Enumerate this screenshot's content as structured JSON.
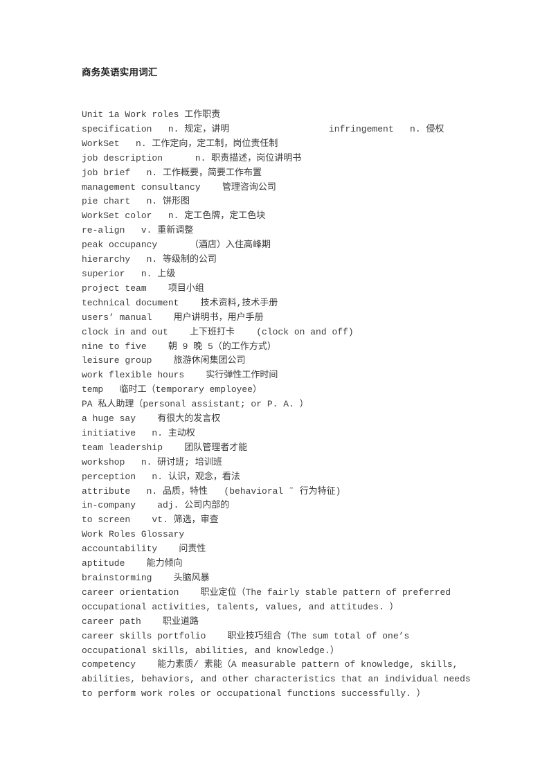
{
  "document": {
    "title": "商务英语实用词汇",
    "background_color": "#ffffff",
    "text_color": "#3a3a3a",
    "title_color": "#1d1d1d"
  },
  "body": {
    "lines": [
      {
        "id": "unit-heading",
        "text": "Unit 1a Work roles 工作职责"
      },
      {
        "id": "specification",
        "text": "specification   n. 规定，讲明",
        "right": "infringement   n. 侵权"
      },
      {
        "id": "workset",
        "text": "WorkSet   n. 工作定向，定工制，岗位责任制"
      },
      {
        "id": "job-description",
        "text": "job description      n. 职责描述，岗位讲明书"
      },
      {
        "id": "job-brief",
        "text": "job brief   n. 工作概要，简要工作布置"
      },
      {
        "id": "management-consultancy",
        "text": "management consultancy    管理咨询公司"
      },
      {
        "id": "pie-chart",
        "text": "pie chart   n. 饼形图"
      },
      {
        "id": "workset-color",
        "text": "WorkSet color   n. 定工色牌，定工色块"
      },
      {
        "id": "re-align",
        "text": "re-align   v. 重新调整"
      },
      {
        "id": "peak-occupancy",
        "text": "peak occupancy      （酒店）入住高峰期"
      },
      {
        "id": "hierarchy",
        "text": "hierarchy   n. 等级制的公司"
      },
      {
        "id": "superior",
        "text": "superior   n. 上级"
      },
      {
        "id": "project-team",
        "text": "project team    项目小组"
      },
      {
        "id": "technical-document",
        "text": "technical document    技术资料,技术手册"
      },
      {
        "id": "users-manual",
        "text": "users’ manual    用户讲明书，用户手册"
      },
      {
        "id": "clock-in-and-out",
        "text": "clock in and out    上下班打卡    (clock on and off)"
      },
      {
        "id": "nine-to-five",
        "text": "nine to five    朝 9 晚 5（的工作方式）"
      },
      {
        "id": "leisure-group",
        "text": "leisure group    旅游休闲集团公司"
      },
      {
        "id": "work-flexible-hours",
        "text": "work flexible hours    实行弹性工作时间"
      },
      {
        "id": "temp",
        "text": "temp   临时工（temporary employee）"
      },
      {
        "id": "pa",
        "text": "PA 私人助理（personal assistant; or P. A. ）"
      },
      {
        "id": "a-huge-say",
        "text": "a huge say    有很大的发言权"
      },
      {
        "id": "initiative",
        "text": "initiative   n. 主动权"
      },
      {
        "id": "team-leadership",
        "text": "team leadership    团队管理者才能"
      },
      {
        "id": "workshop",
        "text": "workshop   n. 研讨班; 培训班"
      },
      {
        "id": "perception",
        "text": "perception   n. 认识，观念，看法"
      },
      {
        "id": "attribute",
        "text": "attribute   n. 品质，特性   (behavioral ˜ 行为特征)"
      },
      {
        "id": "in-company",
        "text": "in-company    adj. 公司内部的"
      },
      {
        "id": "to-screen",
        "text": "to screen    vt. 筛选，审查"
      },
      {
        "id": "work-roles-glossary",
        "text": "Work Roles Glossary"
      },
      {
        "id": "accountability",
        "text": "accountability    问责性"
      },
      {
        "id": "aptitude",
        "text": "aptitude    能力倾向"
      },
      {
        "id": "brainstorming",
        "text": "brainstorming    头脑风暴"
      },
      {
        "id": "career-orientation",
        "text": "career orientation    职业定位（The fairly stable pattern of preferred occupational activities, talents, values, and attitudes. ）"
      },
      {
        "id": "career-path",
        "text": "career path    职业道路"
      },
      {
        "id": "career-skills-portfolio",
        "text": "career skills portfolio    职业技巧组合（The sum total of one’s occupational skills, abilities, and knowledge.）"
      },
      {
        "id": "competency",
        "text": "competency    能力素质/ 素能（A measurable pattern of knowledge, skills, abilities, behaviors, and other characteristics that an individual needs to perform work roles or occupational functions successfully. ）"
      }
    ]
  }
}
